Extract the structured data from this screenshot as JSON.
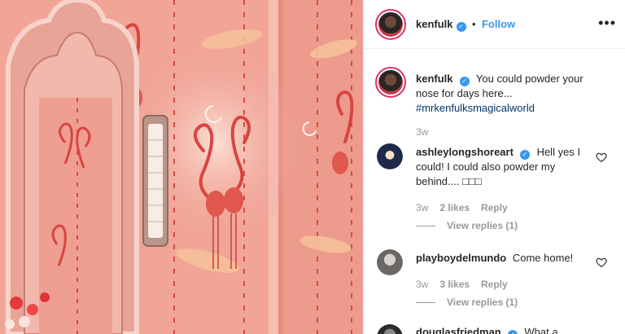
{
  "post_author": {
    "username": "kenfulk",
    "verified": true,
    "follow_label": "Follow",
    "separator": "•",
    "more_icon": "more-options-icon"
  },
  "caption": {
    "username": "kenfulk",
    "text": "You could powder your nose for days here...",
    "hashtag": "#mrkenfulksmagicalworld",
    "time": "3w"
  },
  "comments": [
    {
      "username": "ashleylongshoreart",
      "verified": true,
      "text": "Hell yes I could! I could also powder my behind.... □□□",
      "time": "3w",
      "likes": "2 likes",
      "reply_label": "Reply",
      "view_replies": "View replies (1)"
    },
    {
      "username": "playboydelmundo",
      "verified": false,
      "text": "Come home!",
      "time": "3w",
      "likes": "3 likes",
      "reply_label": "Reply",
      "view_replies": "View replies (1)"
    },
    {
      "username": "douglasfriedman",
      "verified": true,
      "text": "What a"
    }
  ],
  "colors": {
    "accent_blue": "#3897f0",
    "hashtag_blue": "#003569",
    "wallpaper_pink": "#f2a89a",
    "flamingo_red": "#d8453f"
  }
}
